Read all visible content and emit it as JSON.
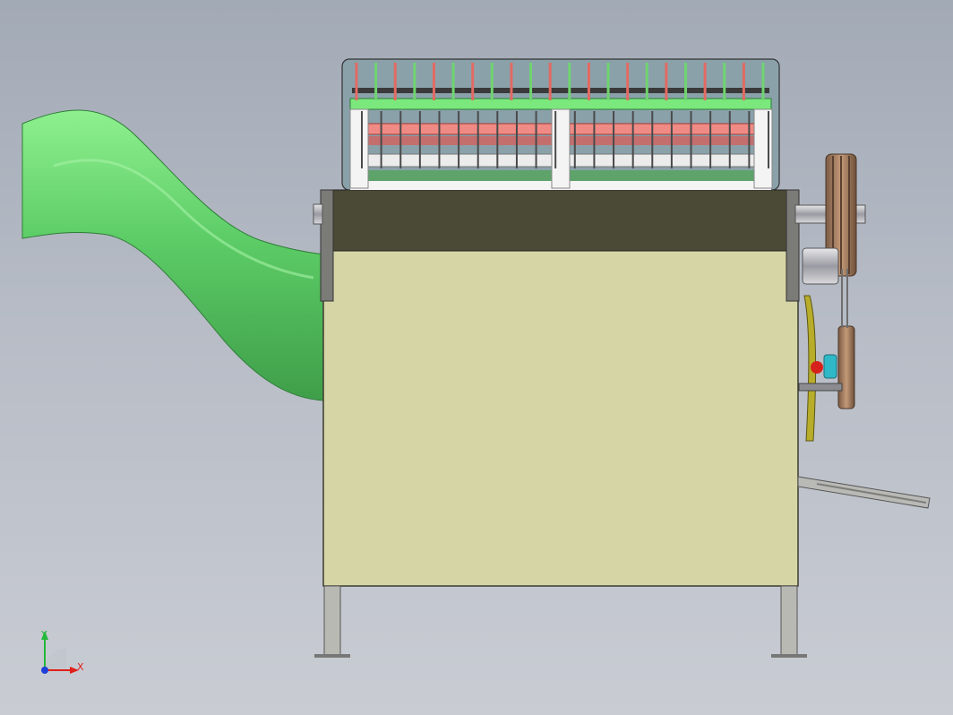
{
  "view": {
    "background_top": "#a2aab6",
    "background_bottom": "#c9ccd3"
  },
  "triad": {
    "x_label": "X",
    "y_label": "Y",
    "x_color": "#e0211b",
    "y_color": "#22b83a",
    "z_color": "#1f3fd8"
  },
  "machine": {
    "body_color": "#d6d5a5",
    "beam_color": "#4b4a36",
    "chute_color": "#5ccc66",
    "green_bar_color": "#7be87d",
    "red_bar_color": "#f08a84",
    "pulley_color": "#b08060",
    "needle_columns": 22
  }
}
